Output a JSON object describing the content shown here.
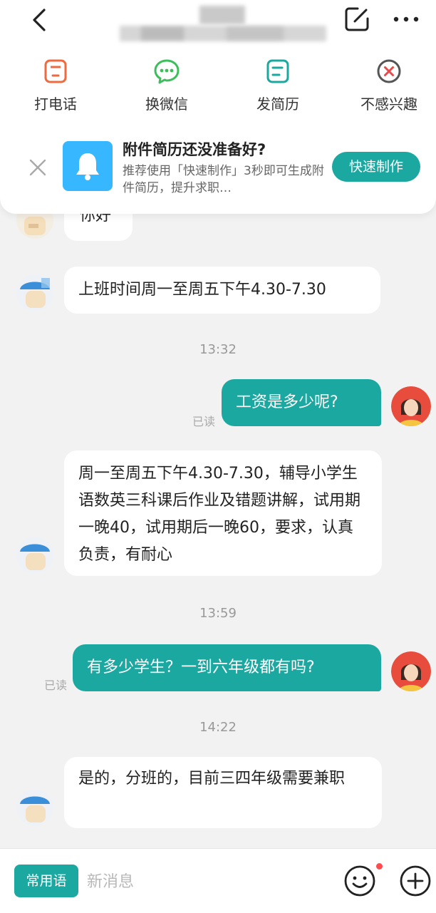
{
  "actions": [
    {
      "label": "打电话",
      "icon": "phone-icon"
    },
    {
      "label": "换微信",
      "icon": "wechat-icon"
    },
    {
      "label": "发简历",
      "icon": "resume-icon"
    },
    {
      "label": "不感兴趣",
      "icon": "not-interested-icon"
    }
  ],
  "promo": {
    "title": "附件简历还没准备好?",
    "desc": "推荐使用「快速制作」3秒即可生成附件简历，提升求职…",
    "button": "快速制作"
  },
  "messages": [
    {
      "partial": "你好"
    },
    {
      "text": "上班时间周一至周五下午4.30-7.30"
    },
    {
      "time": "13:32"
    },
    {
      "text": "工资是多少呢?",
      "read": "已读"
    },
    {
      "text": "周一至周五下午4.30-7.30，辅导小学生语数英三科课后作业及错题讲解，试用期一晚40，试用期后一晚60，要求，认真负责，有耐心"
    },
    {
      "time": "13:59"
    },
    {
      "text": "有多少学生？一到六年级都有吗?",
      "read": "已读"
    },
    {
      "time": "14:22"
    },
    {
      "text": "是的，分班的，目前三四年级需要兼职"
    }
  ],
  "bottom": {
    "phrase_button": "常用语",
    "input_placeholder": "新消息"
  },
  "colors": {
    "accent": "#1aa8a0",
    "promo_icon_bg": "#36b7ff",
    "dot": "#ff4d4f"
  }
}
